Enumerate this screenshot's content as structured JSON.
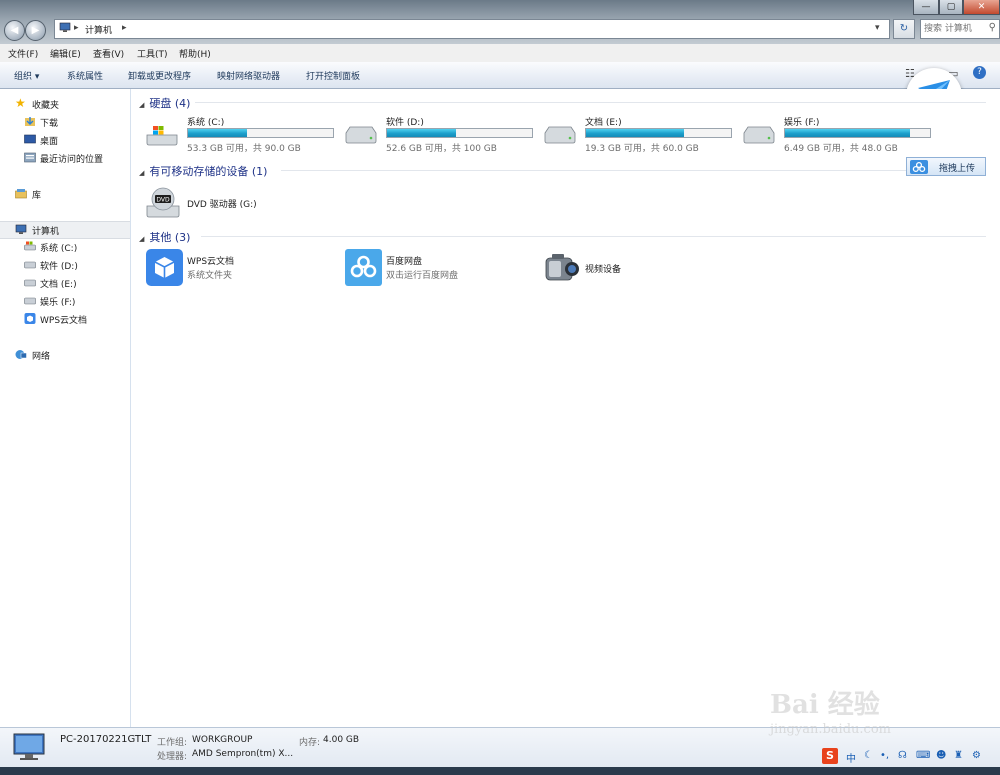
{
  "window": {
    "breadcrumb": [
      "计算机"
    ],
    "search_placeholder": "搜索 计算机",
    "controls": [
      "—",
      "▢",
      "✕"
    ]
  },
  "menubar": [
    "文件(F)",
    "编辑(E)",
    "查看(V)",
    "工具(T)",
    "帮助(H)"
  ],
  "toolbar": [
    "组织 ▾",
    "系统属性",
    "卸载或更改程序",
    "映射网络驱动器",
    "打开控制面板"
  ],
  "nav": {
    "favorites_label": "收藏夹",
    "favorites": [
      "下载",
      "桌面",
      "最近访问的位置"
    ],
    "library_label": "库",
    "computer_label": "计算机",
    "computer_items": [
      "系统 (C:)",
      "软件 (D:)",
      "文档 (E:)",
      "娱乐 (F:)",
      "WPS云文档"
    ],
    "network_label": "网络"
  },
  "groups": {
    "hdd": "硬盘 (4)",
    "removable": "有可移动存储的设备 (1)",
    "other": "其他 (3)"
  },
  "drives": [
    {
      "name": "系统 (C:)",
      "free": "53.3 GB 可用，共 90.0 GB",
      "used_fraction": 0.408
    },
    {
      "name": "软件 (D:)",
      "free": "52.6 GB 可用，共 100 GB",
      "used_fraction": 0.474
    },
    {
      "name": "文档 (E:)",
      "free": "19.3 GB 可用，共 60.0 GB",
      "used_fraction": 0.678
    },
    {
      "name": "娱乐 (F:)",
      "free": "6.49 GB 可用，共 48.0 GB",
      "used_fraction": 0.865
    }
  ],
  "dvd": {
    "name": "DVD 驱动器 (G:)",
    "icon_text": "DVD"
  },
  "others": [
    {
      "title": "WPS云文档",
      "subtitle": "系统文件夹"
    },
    {
      "title": "百度网盘",
      "subtitle": "双击运行百度网盘"
    },
    {
      "title": "视频设备",
      "subtitle": ""
    }
  ],
  "upload_button": "拖拽上传",
  "details": {
    "pc_name": "PC-20170221GTLT",
    "workgroup_label": "工作组:",
    "workgroup": "WORKGROUP",
    "memory_label": "内存:",
    "memory": "4.00 GB",
    "cpu_label": "处理器:",
    "cpu": "AMD Sempron(tm) X..."
  },
  "tray": [
    "中"
  ],
  "watermark": {
    "line1": "Bai 经验",
    "line2": "jingyan.baidu.com"
  }
}
